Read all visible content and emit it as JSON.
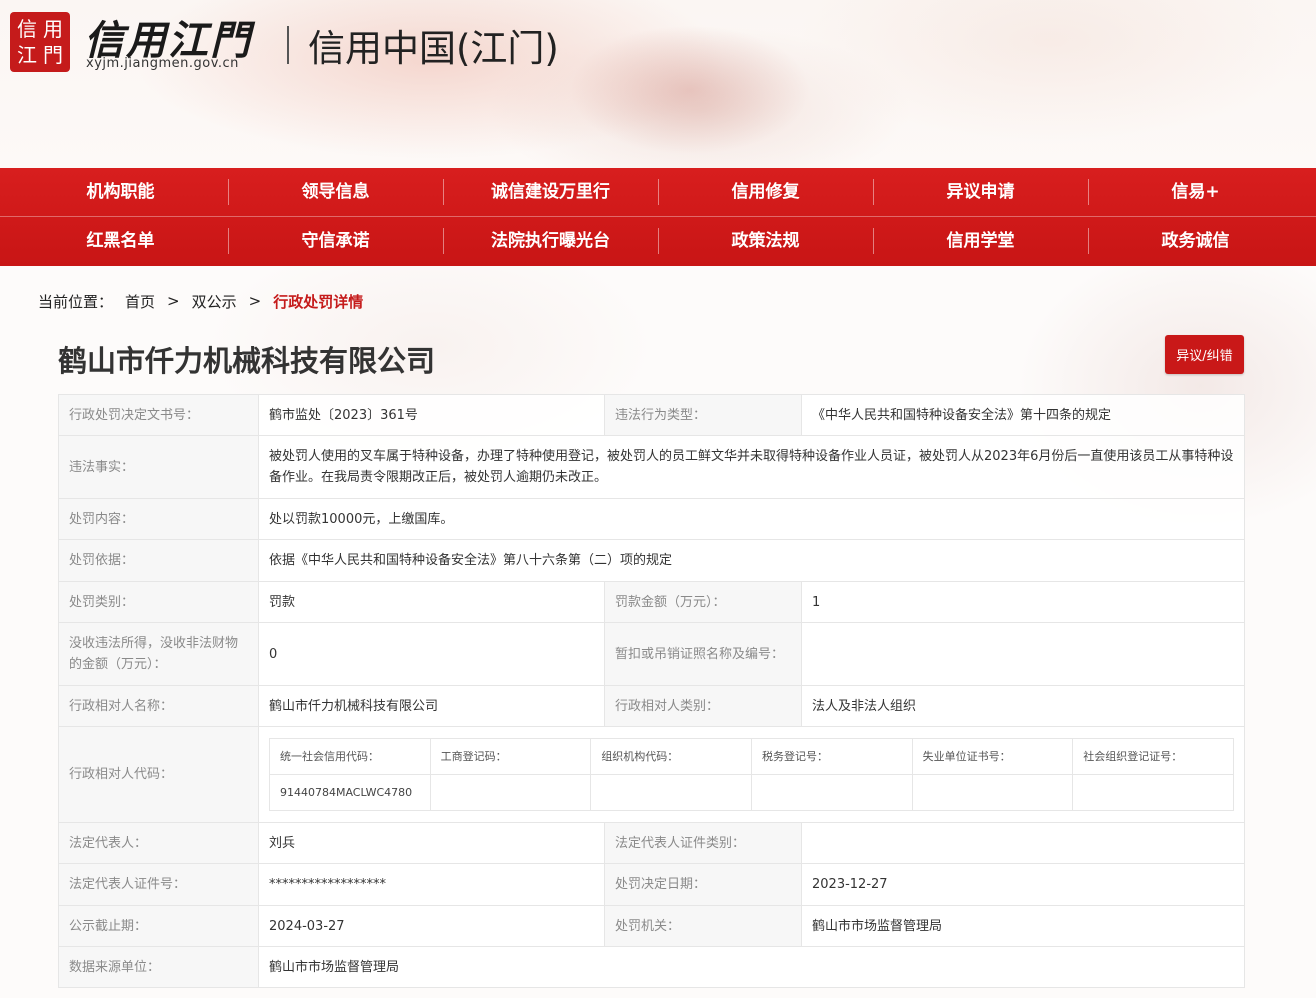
{
  "header": {
    "seal_chars": [
      "信",
      "用",
      "江",
      "門"
    ],
    "logo_title": "信用江門",
    "logo_url": "xyjm.jiangmen.gov.cn",
    "site_title": "信用中国(江门)"
  },
  "nav": {
    "row1": [
      "机构职能",
      "领导信息",
      "诚信建设万里行",
      "信用修复",
      "异议申请",
      "信易+"
    ],
    "row2": [
      "红黑名单",
      "守信承诺",
      "法院执行曝光台",
      "政策法规",
      "信用学堂",
      "政务诚信"
    ]
  },
  "breadcrumb": {
    "label": "当前位置：",
    "home": "首页",
    "sep1": ">",
    "section": "双公示",
    "sep2": ">",
    "current": "行政处罚详情"
  },
  "company_name": "鹤山市仟力机械科技有限公司",
  "objection_button": "异议/纠错",
  "details": {
    "doc_no_label": "行政处罚决定文书号：",
    "doc_no": "鹤市监处〔2023〕361号",
    "violation_type_label": "违法行为类型：",
    "violation_type": "《中华人民共和国特种设备安全法》第十四条的规定",
    "facts_label": "违法事实：",
    "facts": "被处罚人使用的叉车属于特种设备，办理了特种使用登记，被处罚人的员工鲜文华并未取得特种设备作业人员证，被处罚人从2023年6月份后一直使用该员工从事特种设备作业。在我局责令限期改正后，被处罚人逾期仍未改正。",
    "content_label": "处罚内容：",
    "content": "处以罚款10000元，上缴国库。",
    "basis_label": "处罚依据：",
    "basis": "依据《中华人民共和国特种设备安全法》第八十六条第（二）项的规定",
    "category_label": "处罚类别：",
    "category": "罚款",
    "amount_label": "罚款金额（万元）：",
    "amount": "1",
    "confiscation_label": "没收违法所得，没收非法财物的金额（万元）：",
    "confiscation": "0",
    "license_label": "暂扣或吊销证照名称及编号：",
    "license": "",
    "party_name_label": "行政相对人名称：",
    "party_name": "鹤山市仟力机械科技有限公司",
    "party_type_label": "行政相对人类别：",
    "party_type": "法人及非法人组织",
    "party_code_label": "行政相对人代码：",
    "codes": {
      "headers": [
        "统一社会信用代码：",
        "工商登记码：",
        "组织机构代码：",
        "税务登记号：",
        "失业单位证书号：",
        "社会组织登记证号："
      ],
      "values": [
        "91440784MACLWC4780",
        "",
        "",
        "",
        "",
        ""
      ]
    },
    "legal_rep_label": "法定代表人：",
    "legal_rep": "刘兵",
    "legal_rep_id_type_label": "法定代表人证件类别：",
    "legal_rep_id_type": "",
    "legal_rep_id_label": "法定代表人证件号：",
    "legal_rep_id": "******************",
    "decision_date_label": "处罚决定日期：",
    "decision_date": "2023-12-27",
    "publish_deadline_label": "公示截止期：",
    "publish_deadline": "2024-03-27",
    "authority_label": "处罚机关：",
    "authority": "鹤山市市场监督管理局",
    "source_label": "数据来源单位：",
    "source": "鹤山市市场监督管理局"
  },
  "colors": {
    "brand_red": "#c91818",
    "nav_red": "#d81e1e",
    "label_gray": "#8a8a8a"
  }
}
